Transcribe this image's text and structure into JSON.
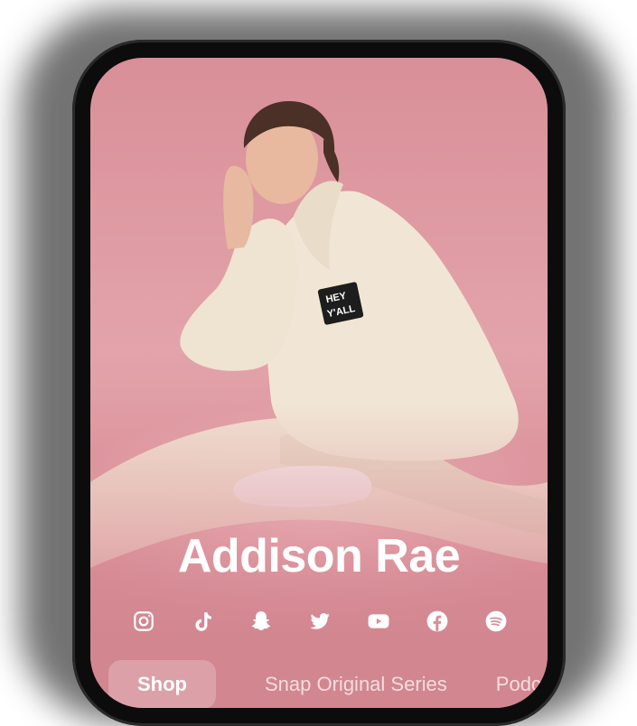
{
  "profile": {
    "name": "Addison Rae",
    "badge_text": "HEY Y'ALL"
  },
  "social_icons": [
    "instagram-icon",
    "tiktok-icon",
    "snapchat-icon",
    "twitter-icon",
    "youtube-icon",
    "facebook-icon",
    "spotify-icon"
  ],
  "tabs": [
    {
      "label": "Shop",
      "active": true
    },
    {
      "label": "Snap Original Series",
      "active": false
    },
    {
      "label": "Podc",
      "active": false
    }
  ],
  "colors": {
    "background_pink": "#d98f98",
    "hoodie": "#f1e6d6",
    "text": "#ffffff"
  }
}
